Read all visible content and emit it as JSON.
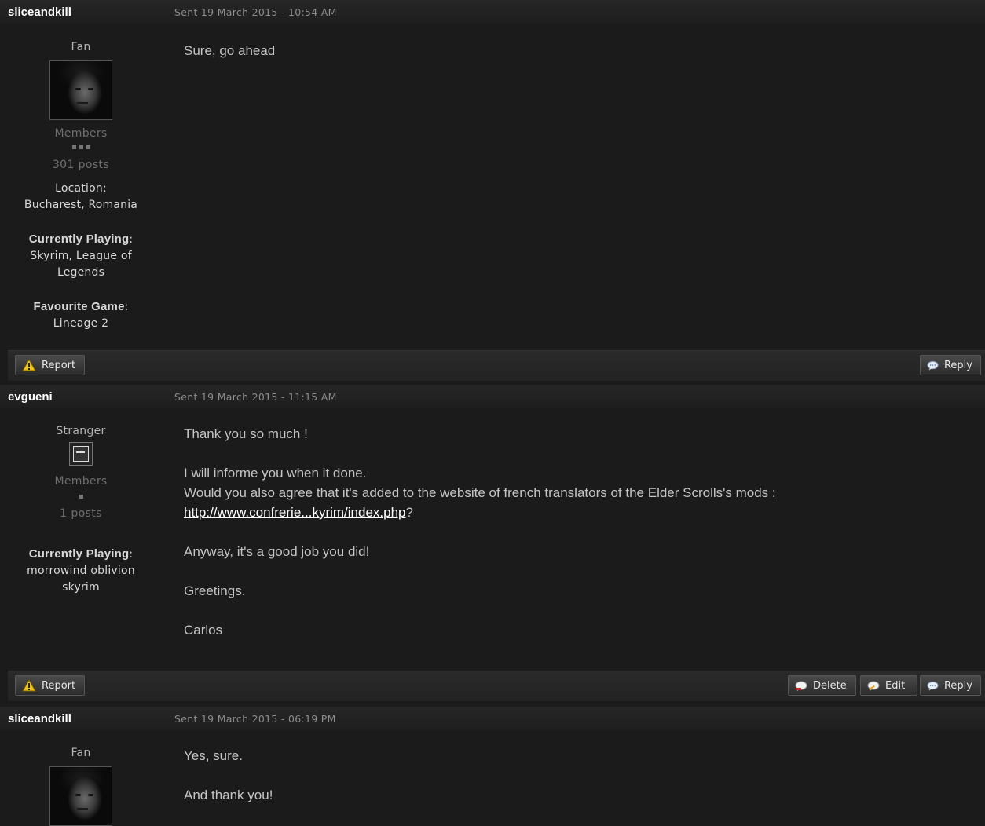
{
  "posts": [
    {
      "author": "sliceandkill",
      "sent": "Sent 19 March 2015 - 10:54 AM",
      "rank": "Fan",
      "group": "Members",
      "pips": 3,
      "postcount": "301 posts",
      "location_label": "Location",
      "location": "Bucharest, Romania",
      "playing_label": "Currently Playing",
      "playing": "Skyrim, League of Legends",
      "fav_label": "Favourite Game",
      "fav": "Lineage 2",
      "content": [
        "Sure, go ahead"
      ]
    },
    {
      "author": "evgueni",
      "sent": "Sent 19 March 2015 - 11:15 AM",
      "rank": "Stranger",
      "group": "Members",
      "pips": 1,
      "postcount": "1 posts",
      "playing_label": "Currently Playing",
      "playing": "morrowind oblivion skyrim",
      "content": {
        "line1": "Thank you so much !",
        "line2": "I will informe you when it done.",
        "line3_prefix": "Would you also agree that it's added to the website of french translators of the Elder Scrolls's mods : ",
        "link": "http://www.confrerie...kyrim/index.php",
        "line3_suffix": "?",
        "line4": "Anyway, it's a good job you did!",
        "line5": "Greetings.",
        "line6": "Carlos"
      }
    },
    {
      "author": "sliceandkill",
      "sent": "Sent 19 March 2015 - 06:19 PM",
      "rank": "Fan",
      "content": [
        "Yes, sure.",
        "And thank you!"
      ]
    }
  ],
  "buttons": {
    "report": "Report",
    "reply": "Reply",
    "delete": "Delete",
    "edit": "Edit"
  },
  "icons": {
    "report": "warning-triangle-icon",
    "reply": "speech-bubble-icon",
    "delete": "speech-bubble-icon",
    "edit": "speech-bubble-icon"
  }
}
